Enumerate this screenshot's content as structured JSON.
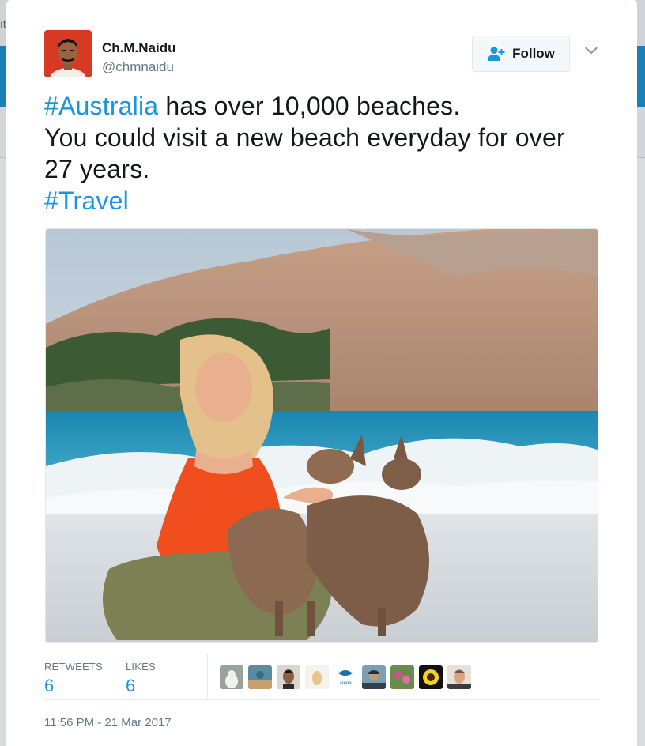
{
  "background": {
    "fragment_text": "ıt"
  },
  "tweet": {
    "author": {
      "name": "Ch.M.Naidu",
      "handle": "@chmnaidu"
    },
    "follow_label": "Follow",
    "text_lines": [
      {
        "hashtag": "#Australia",
        "text": " has over 10,000 beaches."
      },
      {
        "text": "You could visit a new beach everyday for over"
      },
      {
        "text": "27 years."
      },
      {
        "hashtag": "#Travel"
      }
    ],
    "stats": {
      "retweets_label": "RETWEETS",
      "retweets": "6",
      "likes_label": "LIKES",
      "likes": "6"
    },
    "liker_avatars": [
      "dog-avatar",
      "person-avatar",
      "person-avatar",
      "light-avatar",
      "weather-arena-avatar",
      "person-avatar",
      "flower-avatar",
      "sunflower-avatar",
      "person-avatar"
    ],
    "timestamp": "11:56 PM - 21 Mar 2017"
  },
  "colors": {
    "link": "#1b95e0",
    "text": "#14171a",
    "secondary": "#657786",
    "header_band": "#1a7fb5"
  },
  "icons": {
    "follow": "follow-user-icon",
    "menu": "chevron-down-icon"
  }
}
